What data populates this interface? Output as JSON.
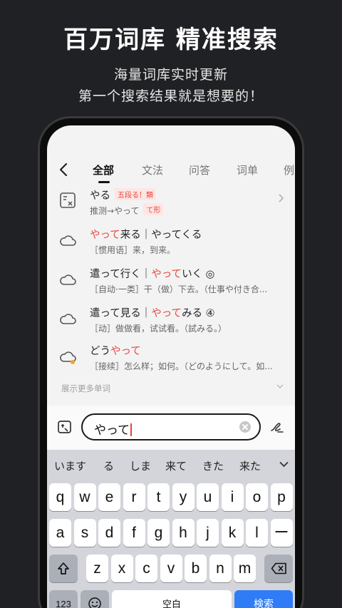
{
  "promo": {
    "title": "百万词库 精准搜索",
    "sub1": "海量词库实时更新",
    "sub2": "第一个搜索结果就是想要的！"
  },
  "tabs": [
    "全部",
    "文法",
    "问答",
    "词单",
    "例"
  ],
  "results": [
    {
      "word": "やる",
      "badge": "五段る！類",
      "def_pre": "推测→やって",
      "def_badge": "て形"
    },
    {
      "word_hl": "やって",
      "word_rest": "来る｜やってくる",
      "def": "［惯用语］来，到来。"
    },
    {
      "word_pre": "遣って行く｜",
      "word_hl": "やって",
      "word_rest": "いく ◎",
      "def": "［自动·一类］干（做）下去。（仕事や付き合..."
    },
    {
      "word_pre": "遣って見る｜",
      "word_hl": "やって",
      "word_rest": "みる ④",
      "def": "［动］做做看，试试看。（試みる。）"
    },
    {
      "word_pre": "どう",
      "word_hl": "やって",
      "def": "［接续］怎么样；如何。（どのようにして。如..."
    }
  ],
  "more_label": "展示更多单词",
  "search": {
    "value": "やって"
  },
  "keyboard": {
    "suggestions": [
      "います",
      "る",
      "しま",
      "来て",
      "きた",
      "来た"
    ],
    "row1": [
      "q",
      "w",
      "e",
      "r",
      "t",
      "y",
      "u",
      "i",
      "o",
      "p"
    ],
    "row2": [
      "a",
      "s",
      "d",
      "f",
      "g",
      "h",
      "j",
      "k",
      "l",
      "ー"
    ],
    "row3": [
      "z",
      "x",
      "c",
      "v",
      "b",
      "n",
      "m"
    ],
    "num_key": "123",
    "space_key": "空白",
    "search_key": "検索"
  },
  "colors": {
    "accent": "#e8453c",
    "background": "#202124",
    "search_key": "#2f7cf6"
  }
}
